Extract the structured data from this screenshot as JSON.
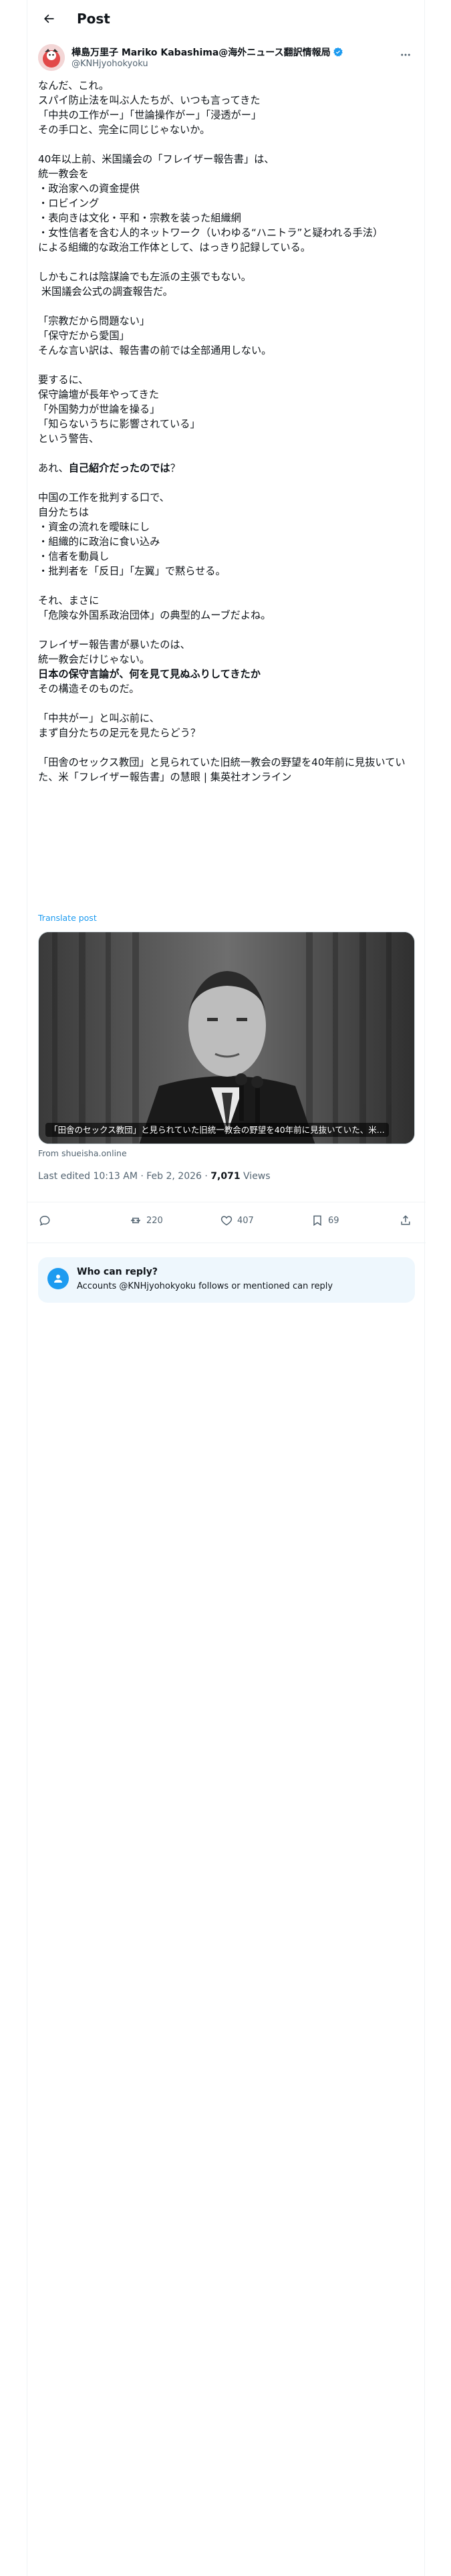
{
  "header": {
    "title": "Post"
  },
  "author": {
    "display_name": "樺島万里子 Mariko Kabashima@海外ニュース翻訳情報局",
    "handle": "@KNHjyohokyoku"
  },
  "post": {
    "blocks": [
      [
        "なんだ、これ。",
        "スパイ防止法を叫ぶ人たちが、いつも言ってきた",
        "「中共の工作がー」「世論操作がー」「浸透がー」",
        "その手口と、完全に同じじゃないか。"
      ],
      [
        "40年以上前、米国議会の「フレイザー報告書」は、",
        "統一教会を",
        "・政治家への資金提供",
        "・ロビイング",
        "・表向きは文化・平和・宗教を装った組織網",
        "・女性信者を含む人的ネットワーク（いわゆる“ハニトラ”と疑われる手法）",
        "による組織的な政治工作体として、はっきり記録している。"
      ],
      [
        "しかもこれは陰謀論でも左派の主張でもない。",
        " 米国議会公式の調査報告だ。"
      ],
      [
        "「宗教だから問題ない」",
        "「保守だから愛国」",
        "そんな言い訳は、報告書の前では全部通用しない。"
      ],
      [
        "要するに、",
        "保守論壇が長年やってきた",
        "「外国勢力が世論を操る」",
        "「知らないうちに影響されている」",
        "という警告、"
      ],
      [
        "あれ、**自己紹介だったのでは**？"
      ],
      [
        "中国の工作を批判する口で、",
        "自分たちは",
        "・資金の流れを曖昧にし",
        "・組織的に政治に食い込み",
        "・信者を動員し",
        "・批判者を「反日」「左翼」で黙らせる。"
      ],
      [
        "それ、まさに",
        "「危険な外国系政治団体」の典型的ムーブだよね。"
      ],
      [
        "フレイザー報告書が暴いたのは、",
        "統一教会だけじゃない。",
        "**日本の保守言論が、何を見て見ぬふりしてきたか**",
        "その構造そのものだ。"
      ],
      [
        "「中共がー」と叫ぶ前に、",
        "まず自分たちの足元を見たらどう？"
      ],
      [
        "「田舎のセックス教団」と見られていた旧統一教会の野望を40年前に見抜いていた、米「フレイザー報告書」の慧眼 | 集英社オンライン"
      ]
    ],
    "translate_label": "Translate post"
  },
  "card": {
    "caption": "「田舎のセックス教団」と見られていた旧統一教会の野望を40年前に見抜いていた、米...",
    "source": "From shueisha.online"
  },
  "meta": {
    "edited": "Last edited 10:13 AM · Feb 2, 2026 · ",
    "views_count": "7,071",
    "views_label": " Views"
  },
  "actions": {
    "reposts": "220",
    "likes": "407",
    "bookmarks": "69"
  },
  "reply_settings": {
    "title": "Who can reply?",
    "subtitle": "Accounts @KNHjyohokyoku follows or mentioned can reply"
  },
  "colors": {
    "accent": "#1d9bf0",
    "text": "#0f1419",
    "muted": "#536471"
  }
}
